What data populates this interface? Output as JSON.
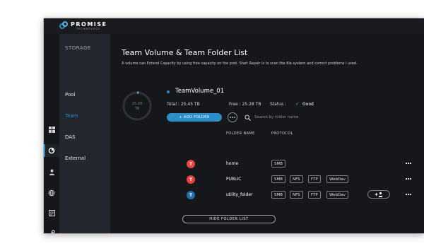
{
  "brand": {
    "name": "PROMISE",
    "tagline": "TECHNOLOGY"
  },
  "rail": {
    "icons": [
      "dashboard-icon",
      "storage-icon",
      "user-icon",
      "network-globe-icon",
      "logs-icon",
      "wrench-icon"
    ],
    "active": "storage-icon"
  },
  "subnav": {
    "section": "STORAGE",
    "items": [
      {
        "label": "Pool",
        "active": false
      },
      {
        "label": "Team",
        "active": true
      },
      {
        "label": "DAS",
        "active": false
      },
      {
        "label": "External",
        "active": false
      }
    ]
  },
  "page": {
    "title": "Team Volume & Team Folder List",
    "description": "A volume can Extend Capacity by using free capacity on the pool. Start Repair is to scan the file system and correct problems i used."
  },
  "volume": {
    "ring_label": "25.28",
    "ring_unit": "TB",
    "name": "TeamVolume_01",
    "total": "Total : 25.45 TB",
    "free": "Free : 25.28 TB",
    "status_label": "Status :",
    "status_value": "Good",
    "used_fraction": 0.007
  },
  "toolbar": {
    "add_folder": "+ ADD FOLDER",
    "search_placeholder": "Search by folder name"
  },
  "table": {
    "headers": {
      "name": "FOLDER NAME",
      "protocol": "PROTOCOL"
    },
    "rows": [
      {
        "avatar": "T",
        "avatar_color": "#e5443f",
        "name": "home",
        "protocols": [
          "SMB"
        ],
        "add_user": false
      },
      {
        "avatar": "T",
        "avatar_color": "#e5443f",
        "name": "PUBLIC",
        "protocols": [
          "SMB",
          "NFS",
          "FTP",
          "WebDav"
        ],
        "add_user": false
      },
      {
        "avatar": "T",
        "avatar_color": "#1f6fa8",
        "name": "utility_folder",
        "protocols": [
          "SMB",
          "NFS",
          "FTP",
          "WebDav"
        ],
        "add_user": true
      }
    ]
  },
  "footer": {
    "hide_label": "HIDE FOLDER LIST"
  },
  "colors": {
    "accent": "#2b8ec9",
    "good": "#3fb950",
    "danger": "#e5443f",
    "teal": "#1f6fa8"
  }
}
